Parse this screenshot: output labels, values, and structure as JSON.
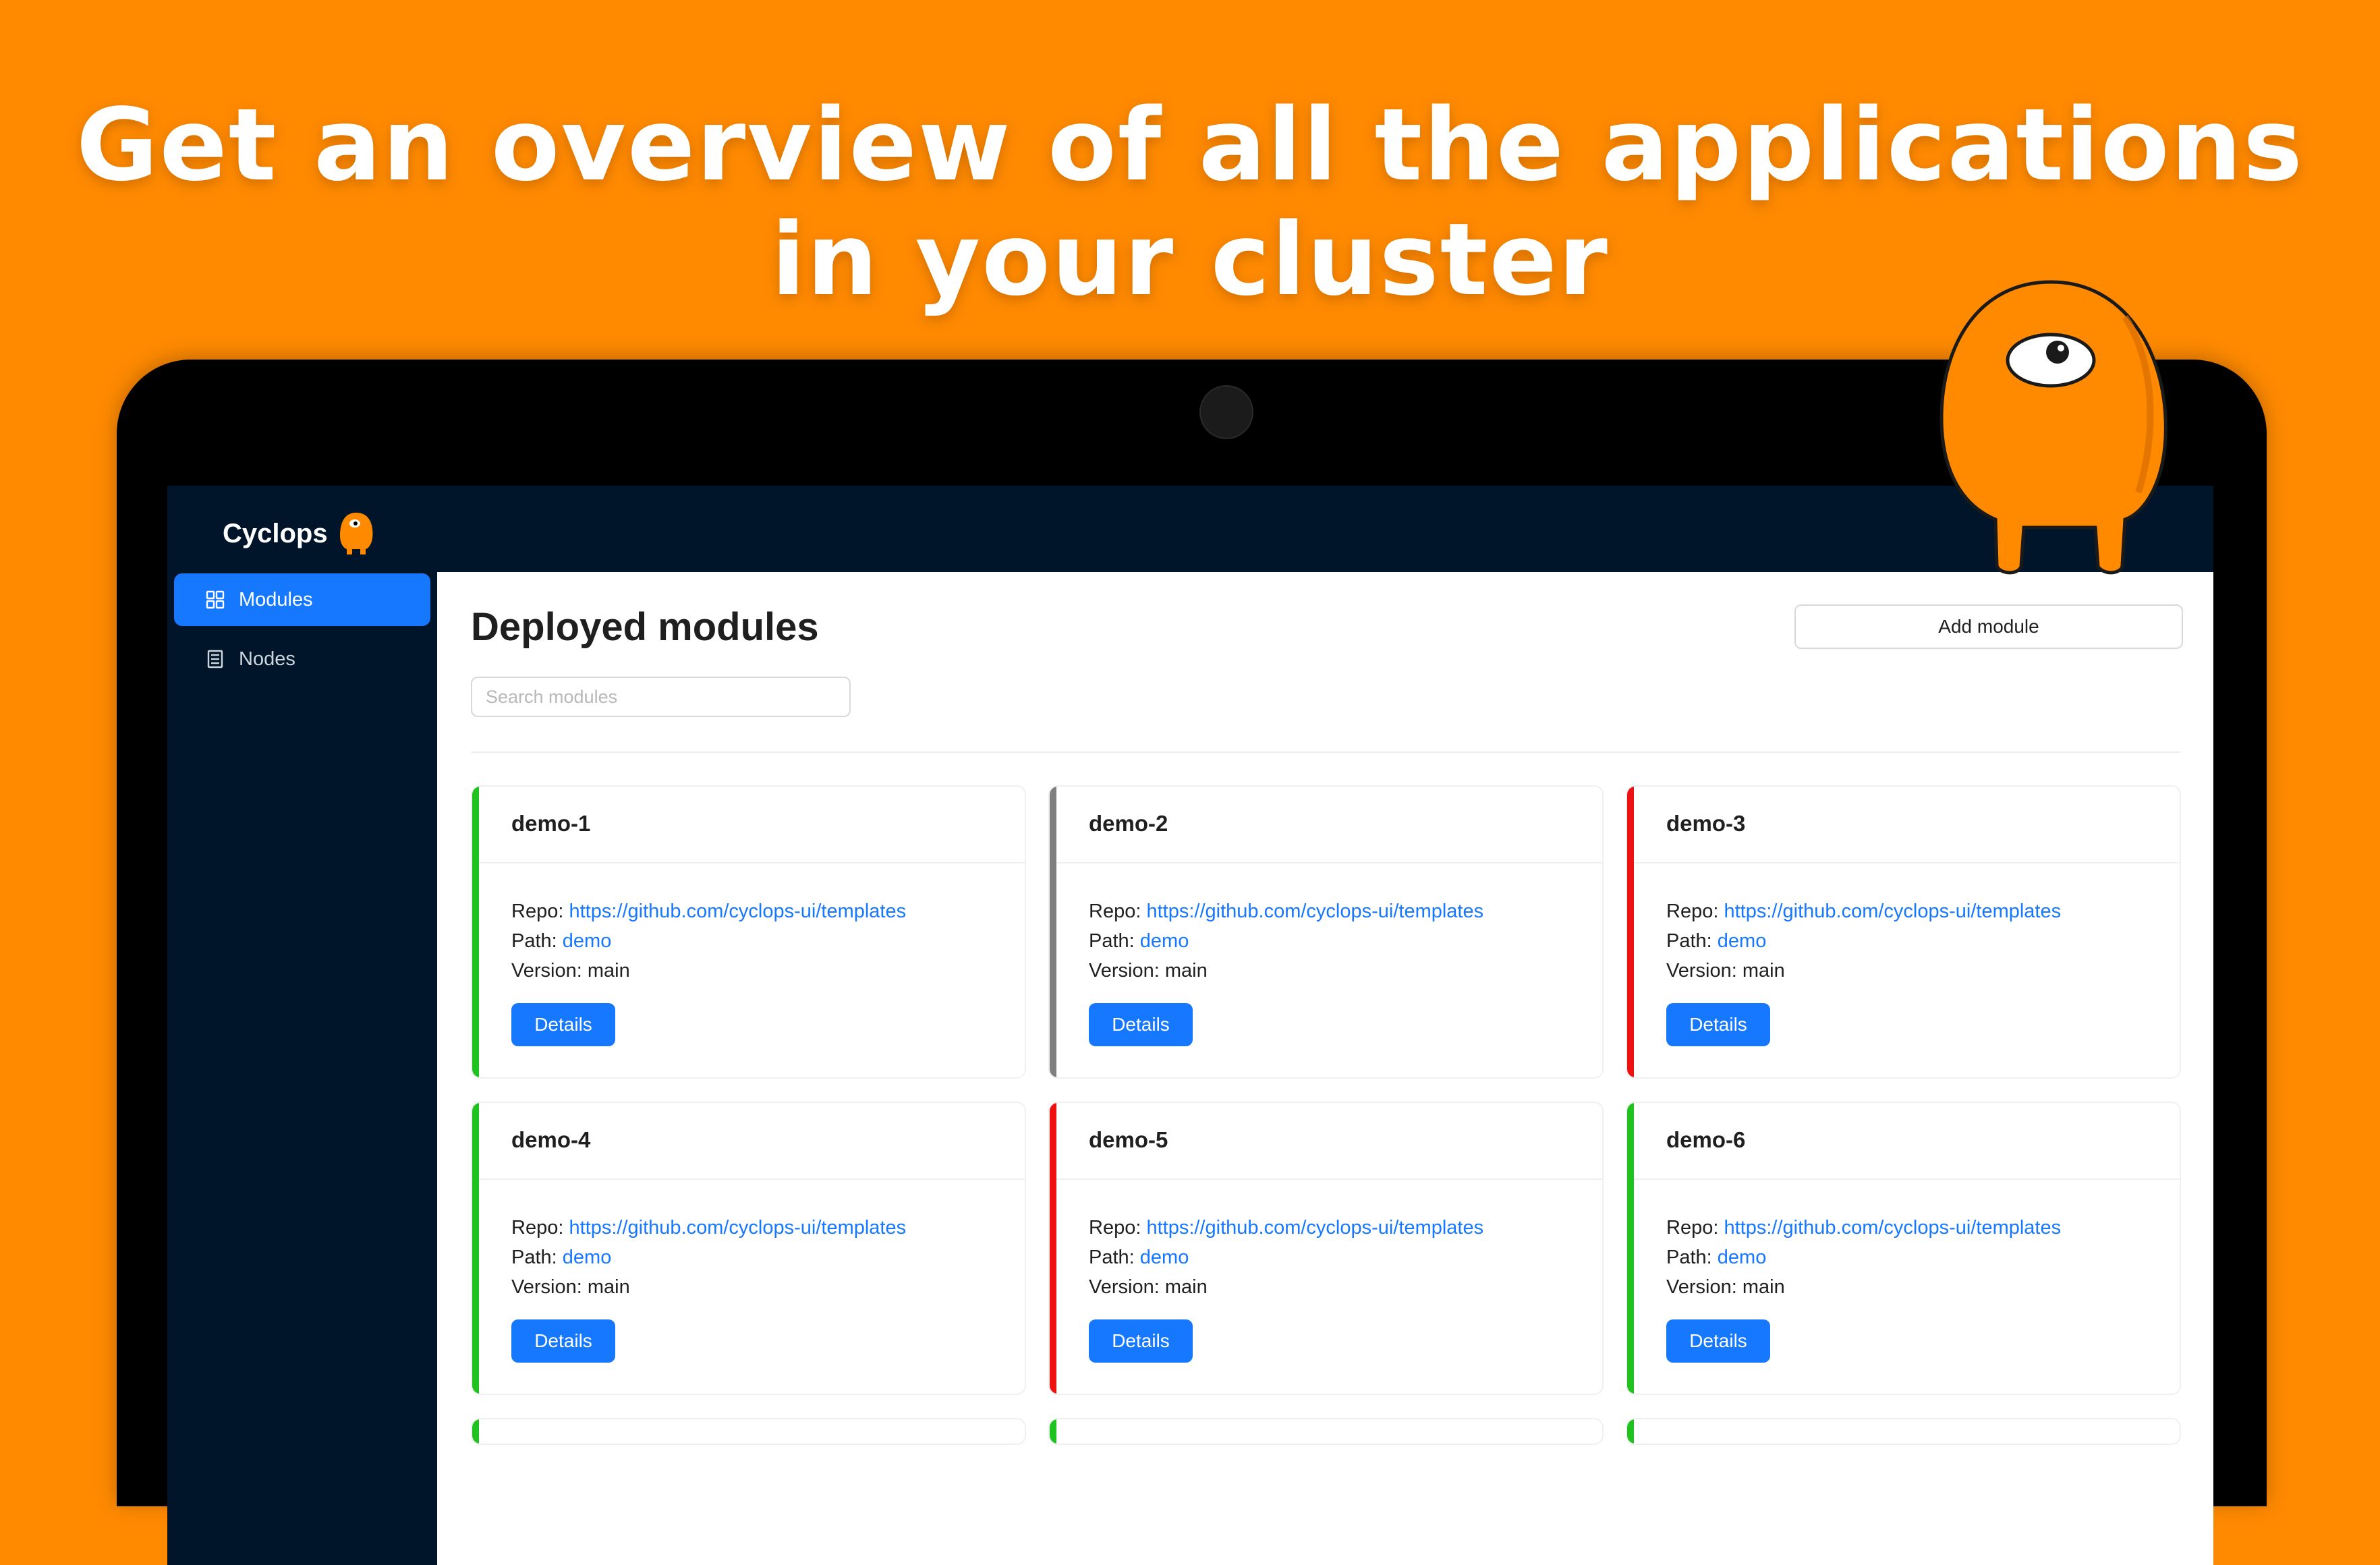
{
  "headline": {
    "line1": "Get an overview of all the applications",
    "line2": "in your cluster"
  },
  "app": {
    "brand": "Cyclops",
    "accent_color": "#1677ff",
    "background_color": "#ff8a00"
  },
  "sidebar": {
    "items": [
      {
        "label": "Modules",
        "icon": "grid-icon",
        "active": true
      },
      {
        "label": "Nodes",
        "icon": "document-icon",
        "active": false
      }
    ]
  },
  "main": {
    "title": "Deployed modules",
    "add_button": "Add module",
    "search_placeholder": "Search modules",
    "search_value": ""
  },
  "cards": [
    {
      "name": "demo-1",
      "status_color": "#1fc21f",
      "repo_label": "Repo:",
      "repo": "https://github.com/cyclops-ui/templates",
      "path_label": "Path:",
      "path": "demo",
      "version_label": "Version:",
      "version": "main",
      "button": "Details"
    },
    {
      "name": "demo-2",
      "status_color": "#7f7f7f",
      "repo_label": "Repo:",
      "repo": "https://github.com/cyclops-ui/templates",
      "path_label": "Path:",
      "path": "demo",
      "version_label": "Version:",
      "version": "main",
      "button": "Details"
    },
    {
      "name": "demo-3",
      "status_color": "#ee1111",
      "repo_label": "Repo:",
      "repo": "https://github.com/cyclops-ui/templates",
      "path_label": "Path:",
      "path": "demo",
      "version_label": "Version:",
      "version": "main",
      "button": "Details"
    },
    {
      "name": "demo-4",
      "status_color": "#1fc21f",
      "repo_label": "Repo:",
      "repo": "https://github.com/cyclops-ui/templates",
      "path_label": "Path:",
      "path": "demo",
      "version_label": "Version:",
      "version": "main",
      "button": "Details"
    },
    {
      "name": "demo-5",
      "status_color": "#ee1111",
      "repo_label": "Repo:",
      "repo": "https://github.com/cyclops-ui/templates",
      "path_label": "Path:",
      "path": "demo",
      "version_label": "Version:",
      "version": "main",
      "button": "Details"
    },
    {
      "name": "demo-6",
      "status_color": "#1fc21f",
      "repo_label": "Repo:",
      "repo": "https://github.com/cyclops-ui/templates",
      "path_label": "Path:",
      "path": "demo",
      "version_label": "Version:",
      "version": "main",
      "button": "Details"
    }
  ]
}
